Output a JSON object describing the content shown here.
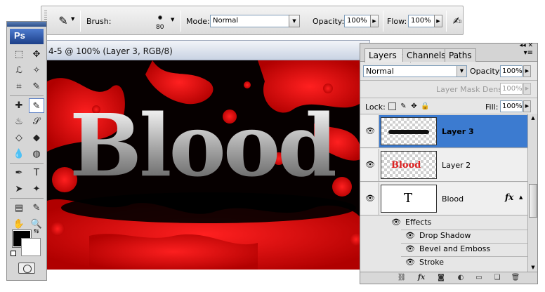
{
  "options_bar": {
    "brush_label": "Brush:",
    "brush_size": "80",
    "mode_label": "Mode:",
    "mode_value": "Normal",
    "opacity_label": "Opacity:",
    "opacity_value": "100%",
    "flow_label": "Flow:",
    "flow_value": "100%"
  },
  "tools": {
    "logo": "Ps",
    "items": [
      {
        "icon": "⬚"
      },
      {
        "icon": "✥"
      },
      {
        "icon": "ℒ"
      },
      {
        "icon": "✧"
      },
      {
        "icon": "⌗"
      },
      {
        "icon": "✎"
      },
      {
        "icon": "✚"
      },
      {
        "icon": "✎"
      },
      {
        "icon": "♨"
      },
      {
        "icon": "𝒮"
      },
      {
        "icon": "◇"
      },
      {
        "icon": "◆"
      },
      {
        "icon": "💧"
      },
      {
        "icon": "◍"
      },
      {
        "icon": "✒"
      },
      {
        "icon": "T"
      },
      {
        "icon": "➤"
      },
      {
        "icon": "✦"
      },
      {
        "icon": "▤"
      },
      {
        "icon": "✎"
      },
      {
        "icon": "✋"
      },
      {
        "icon": "🔍"
      }
    ]
  },
  "document": {
    "title": "4-5 @ 100% (Layer 3, RGB/8)",
    "canvas_text": "Blood"
  },
  "layers_panel": {
    "tabs": [
      {
        "label": "Layers",
        "active": true
      },
      {
        "label": "Channels",
        "active": false
      },
      {
        "label": "Paths",
        "active": false
      }
    ],
    "blend_mode": "Normal",
    "opacity_label": "Opacity:",
    "opacity_value": "100%",
    "mask_density_label": "Layer Mask Density",
    "mask_density_value": "100%",
    "lock_label": "Lock:",
    "fill_label": "Fill:",
    "fill_value": "100%",
    "layers": [
      {
        "name": "Layer 3",
        "selected": true
      },
      {
        "name": "Layer 2",
        "selected": false,
        "thumb_text": "Blood"
      },
      {
        "name": "Blood",
        "selected": false,
        "thumb_text": "T",
        "fx": "fx"
      }
    ],
    "effects_label": "Effects",
    "effects": [
      "Drop Shadow",
      "Bevel and Emboss",
      "Stroke"
    ],
    "fx_button": "fx"
  },
  "colors": {
    "selection": "#3c7bd0",
    "blood_red": "#e00000",
    "foreground": "#000000",
    "background": "#ffffff"
  }
}
